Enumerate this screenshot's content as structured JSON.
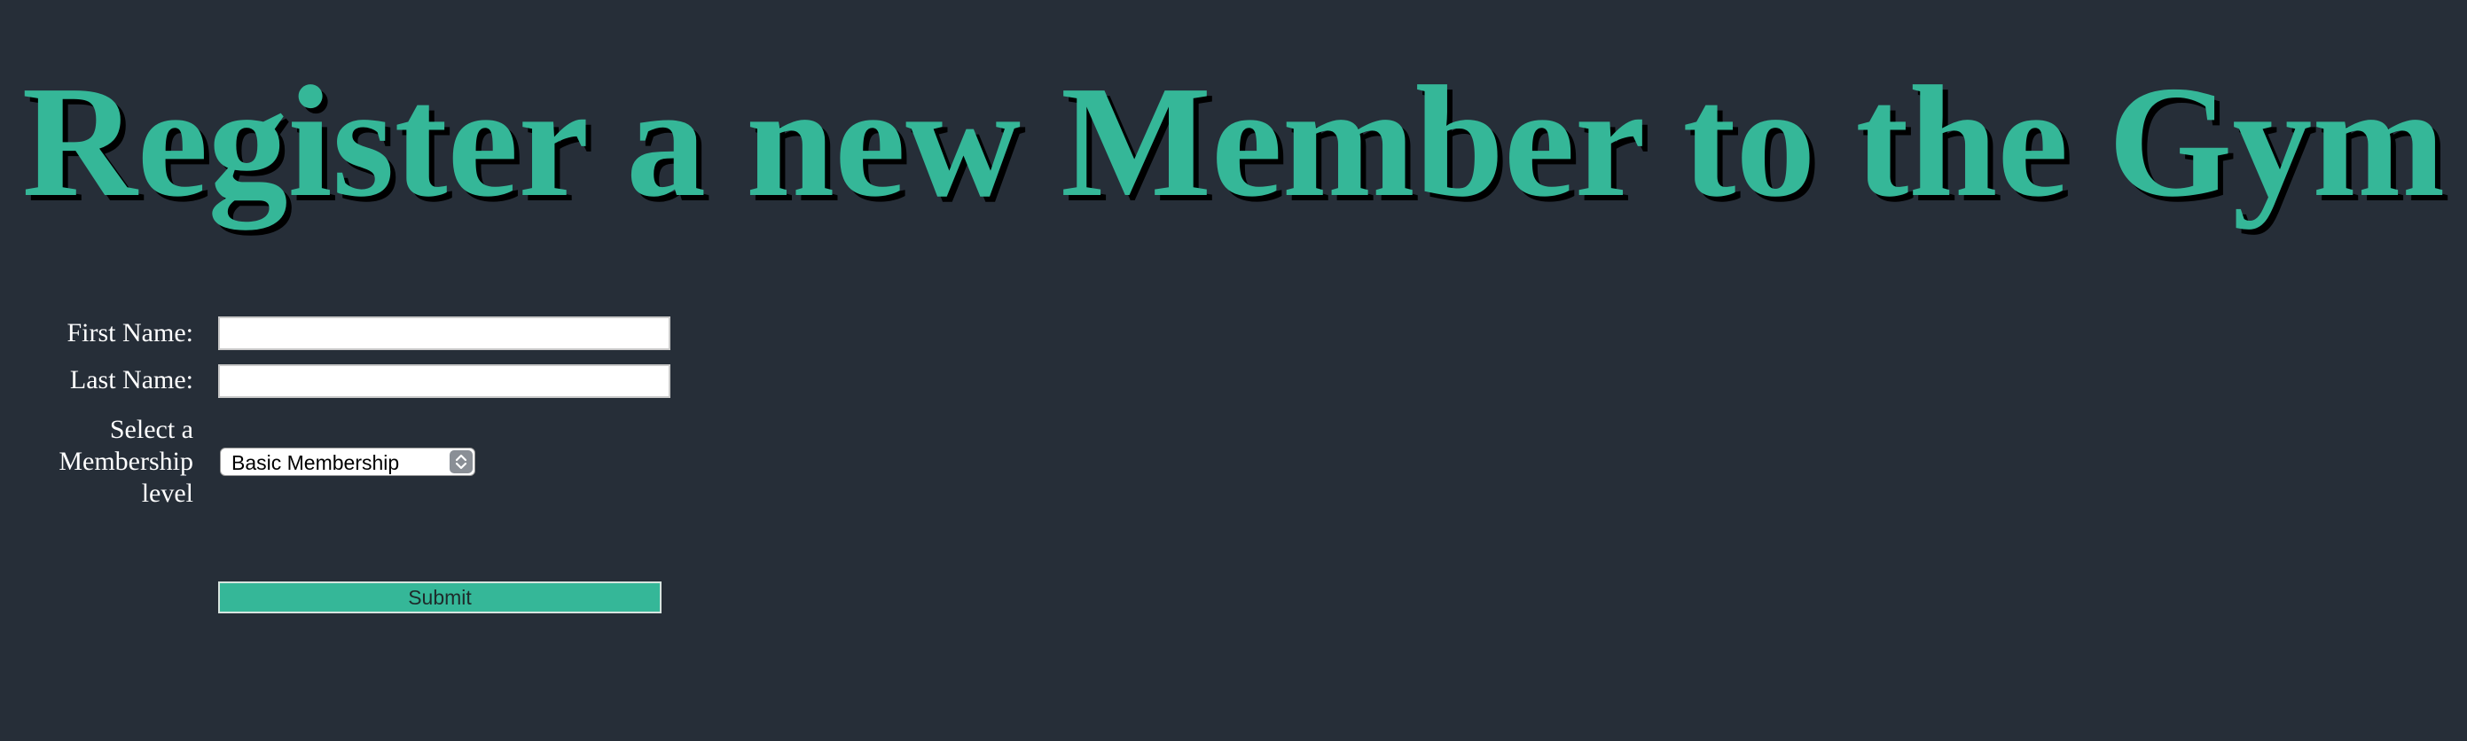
{
  "page": {
    "title": "Register a new Member to the Gym"
  },
  "form": {
    "first_name": {
      "label": "First Name:",
      "value": "",
      "placeholder": ""
    },
    "last_name": {
      "label": "Last Name:",
      "value": "",
      "placeholder": ""
    },
    "membership": {
      "label_lines": [
        "Select a",
        "Membership",
        "level"
      ],
      "selected": "Basic Membership"
    },
    "submit_label": "Submit"
  },
  "colors": {
    "background": "#262e38",
    "accent": "#35b798",
    "title_shadow": "#000000",
    "label_text": "#ffffff"
  },
  "icons": {
    "select_arrows": "chevron-up-down-icon"
  }
}
